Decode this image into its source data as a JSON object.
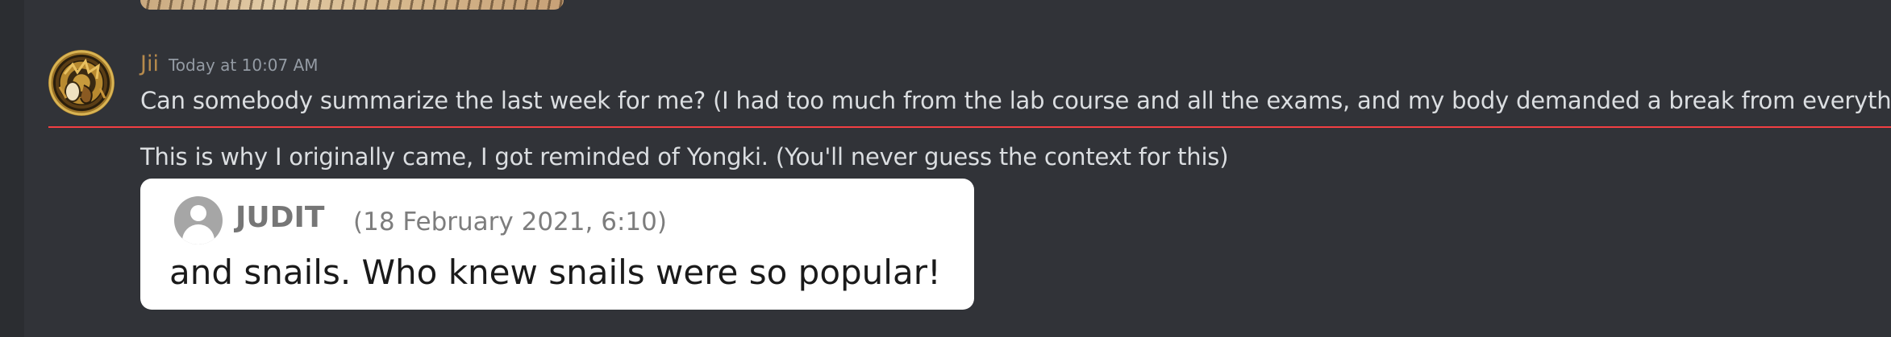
{
  "message": {
    "username": "Jii",
    "timestamp": "Today at 10:07 AM",
    "username_color": "#b68a4c",
    "lines": [
      "Can somebody summarize the last week for me? (I had too much from the lab course and all the exams, and my body demanded a break from everything)",
      "This is why I originally came, I got reminded of Yongki. (You'll never guess the context for this)"
    ]
  },
  "new_messages_divider_color": "#f23f43",
  "embed_image": {
    "avatar_icon": "default-user-icon",
    "name": "JUDIT",
    "date": "(18 February 2021, 6:10)",
    "quote": "and snails. Who knew snails were so popular!"
  }
}
